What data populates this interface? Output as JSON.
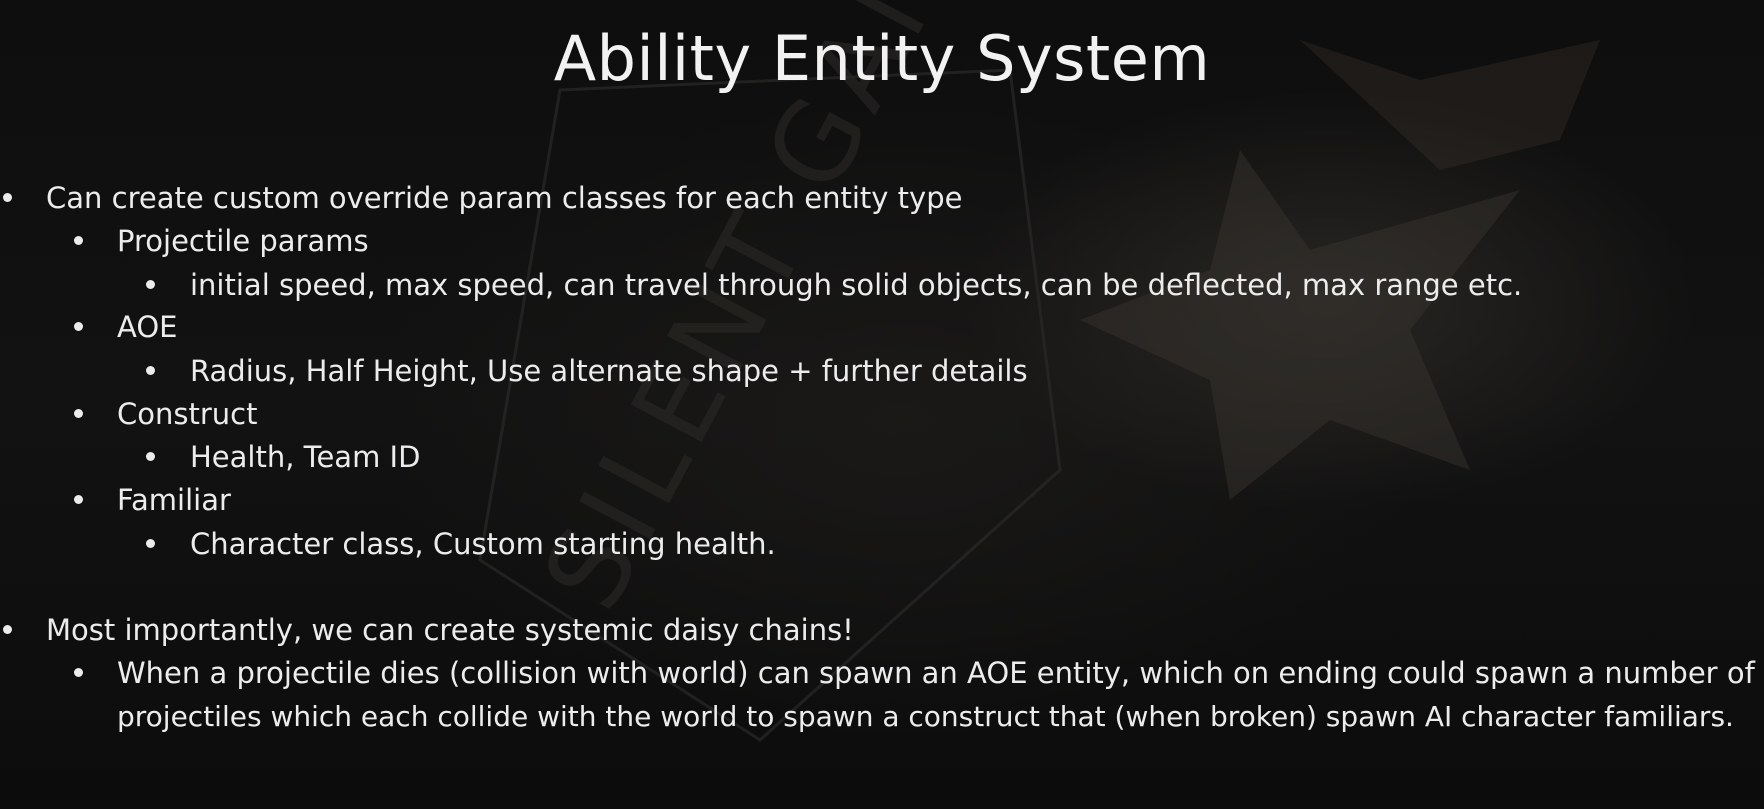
{
  "slide": {
    "title": "Ability Entity System",
    "watermark_text": "SILENT GAMES",
    "bullets": {
      "custom_params": "Can create custom override param classes for each entity type",
      "projectile": "Projectile params",
      "projectile_details": "initial speed, max speed, can travel through solid objects, can be deflected, max range etc.",
      "aoe": "AOE",
      "aoe_details": "Radius, Half Height, Use alternate shape + further details",
      "construct": "Construct",
      "construct_details": "Health, Team ID",
      "familiar": "Familiar",
      "familiar_details": "Character class, Custom starting health.",
      "daisy_chains": "Most importantly, we can create systemic daisy chains!",
      "daisy_example_line1": "When a projectile dies (collision with world) can spawn an AOE entity, which on ending could spawn a number of",
      "daisy_example_line2": "projectiles which each collide with the world to spawn a construct that (when broken) spawn AI character familiars."
    }
  },
  "colors": {
    "background": "#0b0b0b",
    "text": "#ececec"
  }
}
